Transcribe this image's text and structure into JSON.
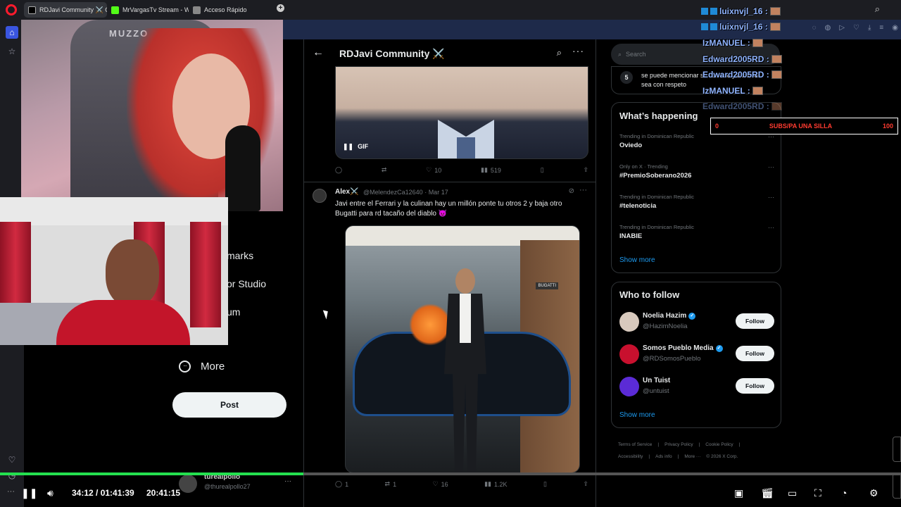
{
  "browser": {
    "tabs": [
      {
        "label": "RDJavi Community ⚔️ C",
        "fav_color": "#000000"
      },
      {
        "label": "MrVargasTv Stream - Watc",
        "fav_color": "#53fc18"
      },
      {
        "label": "Acceso Rápido",
        "fav_color": "#888888"
      }
    ]
  },
  "left_nav": {
    "items": [
      "marks",
      "or Studio",
      "um"
    ],
    "more_label": "More",
    "post_label": "Post"
  },
  "main": {
    "title": "RDJavi Community ⚔️",
    "gif_label": "GIF",
    "tweet1_actions": {
      "reply": "",
      "retweet": "",
      "like": "10",
      "views": "519"
    },
    "tweet2": {
      "name": "Alex⚔️",
      "handle_date": "@MelendezCa12640 · Mar 17",
      "text": "Javi entre el Ferrari y la culinan hay un millón ponte tu otros 2 y baja otro Bugatti para rd tacaño del diablo 😈",
      "image_sign": "BUGATTI",
      "actions": {
        "reply": "1",
        "retweet": "1",
        "like": "16",
        "views": "1.2K"
      }
    }
  },
  "right": {
    "search_placeholder": "Search",
    "top_trend": {
      "number": "5",
      "text": "se puede mencionar su nombre y cuando sea con respeto"
    },
    "whats_happening": {
      "title": "What’s happening",
      "trends": [
        {
          "meta": "Trending in Dominican Republic",
          "name": "Oviedo"
        },
        {
          "meta": "Only on X · Trending",
          "name": "#PremioSoberano2026"
        },
        {
          "meta": "Trending in Dominican Republic",
          "name": "#telenoticia"
        },
        {
          "meta": "Trending in Dominican Republic",
          "name": "INABIE"
        }
      ],
      "show_more": "Show more"
    },
    "who_to_follow": {
      "title": "Who to follow",
      "accounts": [
        {
          "name": "Noelia Hazim",
          "handle": "@HazimNoelia",
          "verified": true,
          "avatar_color": "#d8c9bd"
        },
        {
          "name": "Somos Pueblo Media",
          "handle": "@RDSomosPueblo",
          "verified": true,
          "avatar_color": "#c8102e"
        },
        {
          "name": "Un Tuist",
          "handle": "@untuist",
          "verified": false,
          "avatar_color": "#5b2bd6"
        }
      ],
      "follow_label": "Follow",
      "show_more": "Show more"
    },
    "footer": [
      "Terms of Service",
      "|",
      "Privacy Policy",
      "|",
      "Cookie Policy",
      "|",
      "Accessibility",
      "|",
      "Ads info",
      "|",
      "More ···",
      "© 2026 X Corp."
    ]
  },
  "stream_overlay": {
    "webcam_brand": "MUZZO",
    "chat": [
      {
        "user": "luixnvjl_16 :",
        "badges": 2
      },
      {
        "user": "luixnvjl_16 :",
        "badges": 2
      },
      {
        "user": "IzMANUEL :",
        "badges": 0
      },
      {
        "user": "Edward2005RD :",
        "badges": 0
      },
      {
        "user": "Edward2005RD :",
        "badges": 0
      },
      {
        "user": "IzMANUEL :",
        "badges": 0
      },
      {
        "user": "Edward2005RD :",
        "badges": 0
      }
    ],
    "subs_goal": {
      "current": "0",
      "label": "SUBS/PA UNA SILLA",
      "target": "100"
    }
  },
  "player": {
    "time": "34:12 / 01:41:39",
    "clock": "20:41:15",
    "progress": 0.337,
    "mini_user": {
      "name": "turealpollo",
      "handle": "@thurealpollo27"
    }
  }
}
